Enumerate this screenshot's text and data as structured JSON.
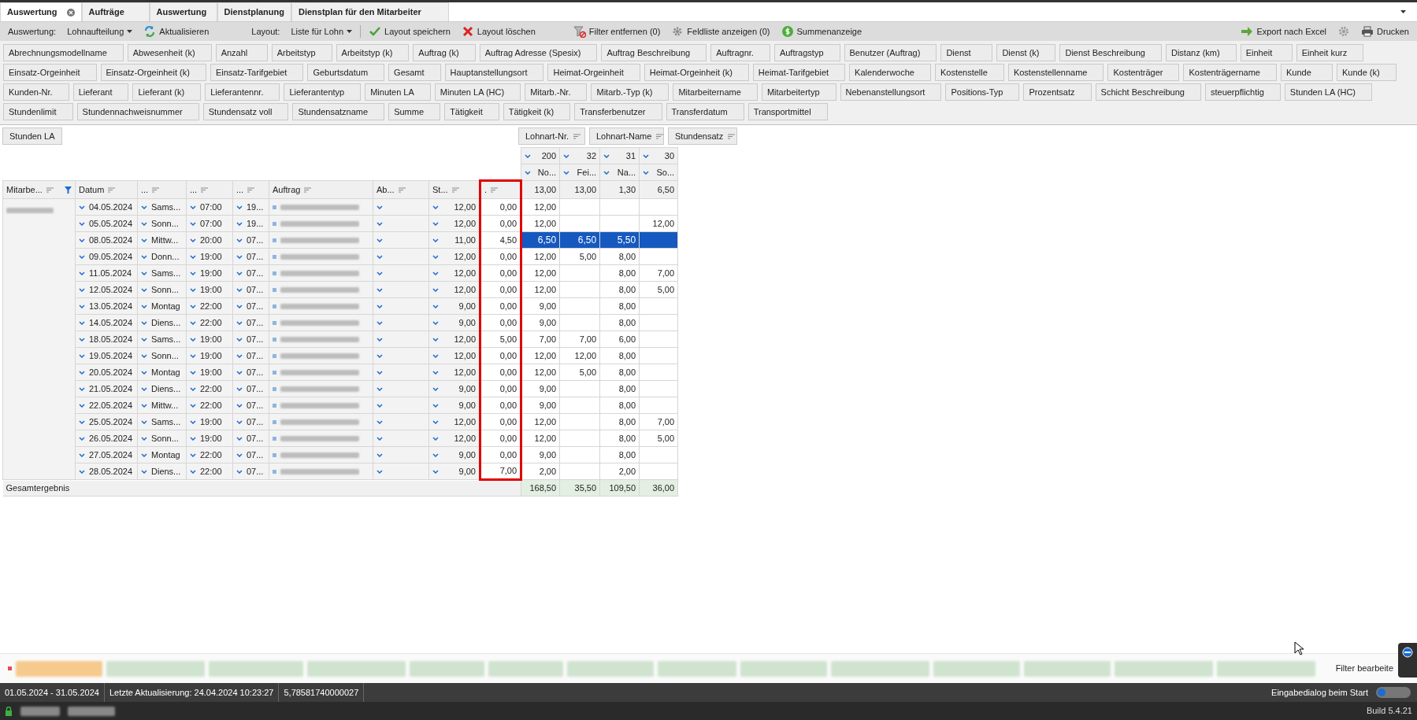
{
  "tabs": [
    {
      "label": "Auswertung",
      "selected": true,
      "closable": true
    },
    {
      "label": "Aufträge",
      "selected": false,
      "closable": false
    },
    {
      "label": "Auswertung",
      "selected": false,
      "closable": false
    },
    {
      "label": "Dienstplanung",
      "selected": false,
      "closable": false
    },
    {
      "label": "Dienstplan für den Mitarbeiter",
      "selected": false,
      "closable": false
    }
  ],
  "toolbar": [
    {
      "kind": "label",
      "text": "Auswertung:"
    },
    {
      "kind": "dropdown",
      "text": "Lohnaufteilung"
    },
    {
      "kind": "refresh",
      "text": "Aktualisieren"
    },
    {
      "kind": "label",
      "text": "Layout:"
    },
    {
      "kind": "dropdown",
      "text": "Liste für Lohn"
    },
    {
      "kind": "save",
      "text": "Layout speichern"
    },
    {
      "kind": "delete",
      "text": "Layout löschen"
    },
    {
      "kind": "filter",
      "text": "Filter entfernen (0)"
    },
    {
      "kind": "fieldlist",
      "text": "Feldliste anzeigen (0)"
    },
    {
      "kind": "sum",
      "text": "Summenanzeige"
    }
  ],
  "toolbar_right": [
    {
      "kind": "export",
      "text": "Export nach Excel"
    },
    {
      "kind": "settings"
    },
    {
      "kind": "print",
      "text": "Drucken"
    }
  ],
  "field_rows": [
    [
      "Abrechnungsmodellname",
      "Abwesenheit (k)",
      "Anzahl",
      "Arbeitstyp",
      "Arbeitstyp (k)",
      "Auftrag (k)",
      "Auftrag Adresse (Spesix)",
      "Auftrag Beschreibung",
      "Auftragnr.",
      "Auftragstyp",
      "Benutzer (Auftrag)",
      "Dienst",
      "Dienst (k)",
      "Dienst Beschreibung",
      "Distanz (km)",
      "Einheit",
      "Einheit kurz"
    ],
    [
      "Einsatz-Orgeinheit",
      "Einsatz-Orgeinheit (k)",
      "Einsatz-Tarifgebiet",
      "Geburtsdatum",
      "Gesamt",
      "Hauptanstellungsort",
      "Heimat-Orgeinheit",
      "Heimat-Orgeinheit (k)",
      "Heimat-Tarifgebiet",
      "Kalenderwoche",
      "Kostenstelle",
      "Kostenstellenname",
      "Kostenträger",
      "Kostenträgername",
      "Kunde",
      "Kunde (k)"
    ],
    [
      "Kunden-Nr.",
      "Lieferant",
      "Lieferant (k)",
      "Lieferantennr.",
      "Lieferantentyp",
      "Minuten LA",
      "Minuten LA (HC)",
      "Mitarb.-Nr.",
      "Mitarb.-Typ (k)",
      "Mitarbeitername",
      "Mitarbeitertyp",
      "Nebenanstellungsort",
      "Positions-Typ",
      "Prozentsatz",
      "Schicht Beschreibung",
      "steuerpflichtig",
      "Stunden LA (HC)"
    ],
    [
      "Stundenlimit",
      "Stundennachweisnummer",
      "Stundensatz voll",
      "Stundensatzname",
      "Summe",
      "Tätigkeit",
      "Tätigkeit (k)",
      "Transferbenutzer",
      "Transferdatum",
      "Transportmittel"
    ]
  ],
  "pivot": {
    "data_field": "Stunden LA",
    "column_fields": [
      "Lohnart-Nr.",
      "Lohnart-Name",
      "Stundensatz"
    ],
    "column_codes": [
      "200",
      "32",
      "31",
      "30"
    ],
    "column_names": [
      "No...",
      "Fei...",
      "Na...",
      "So..."
    ],
    "row_headers": [
      {
        "label": "Mitarbe...",
        "filtered": true
      },
      {
        "label": "Datum",
        "filtered": false
      },
      {
        "label": "...",
        "filtered": false
      },
      {
        "label": "...",
        "filtered": false
      },
      {
        "label": "...",
        "filtered": false
      },
      {
        "label": "Auftrag",
        "filtered": false
      },
      {
        "label": "Ab...",
        "filtered": false
      },
      {
        "label": "St...",
        "filtered": false
      },
      {
        "label": ".",
        "filtered": false
      }
    ],
    "header_totals": [
      "13,00",
      "13,00",
      "1,30",
      "6,50"
    ],
    "rows": [
      {
        "date": "04.05.2024",
        "day": "Sams...",
        "start": "07:00",
        "end": "19...",
        "hours": "12,00",
        "extra": "0,00",
        "value_1": "12,00",
        "selected": false
      },
      {
        "date": "05.05.2024",
        "day": "Sonn...",
        "start": "07:00",
        "end": "19...",
        "hours": "12,00",
        "extra": "0,00",
        "value_1": "12,00",
        "value_4": "12,00",
        "selected": false
      },
      {
        "date": "08.05.2024",
        "day": "Mittw...",
        "start": "20:00",
        "end": "07...",
        "hours": "11,00",
        "extra": "4,50",
        "value_1": "6,50",
        "value_2": "6,50",
        "value_3": "5,50",
        "selected": true
      },
      {
        "date": "09.05.2024",
        "day": "Donn...",
        "start": "19:00",
        "end": "07...",
        "hours": "12,00",
        "extra": "0,00",
        "value_1": "12,00",
        "value_2": "5,00",
        "value_3": "8,00",
        "selected": false
      },
      {
        "date": "11.05.2024",
        "day": "Sams...",
        "start": "19:00",
        "end": "07...",
        "hours": "12,00",
        "extra": "0,00",
        "value_1": "12,00",
        "value_3": "8,00",
        "value_4": "7,00",
        "selected": false
      },
      {
        "date": "12.05.2024",
        "day": "Sonn...",
        "start": "19:00",
        "end": "07...",
        "hours": "12,00",
        "extra": "0,00",
        "value_1": "12,00",
        "value_3": "8,00",
        "value_4": "5,00",
        "selected": false
      },
      {
        "date": "13.05.2024",
        "day": "Montag",
        "start": "22:00",
        "end": "07...",
        "hours": "9,00",
        "extra": "0,00",
        "value_1": "9,00",
        "value_3": "8,00",
        "selected": false
      },
      {
        "date": "14.05.2024",
        "day": "Diens...",
        "start": "22:00",
        "end": "07...",
        "hours": "9,00",
        "extra": "0,00",
        "value_1": "9,00",
        "value_3": "8,00",
        "selected": false
      },
      {
        "date": "18.05.2024",
        "day": "Sams...",
        "start": "19:00",
        "end": "07...",
        "hours": "12,00",
        "extra": "5,00",
        "value_1": "7,00",
        "value_2": "7,00",
        "value_3": "6,00",
        "selected": false
      },
      {
        "date": "19.05.2024",
        "day": "Sonn...",
        "start": "19:00",
        "end": "07...",
        "hours": "12,00",
        "extra": "0,00",
        "value_1": "12,00",
        "value_2": "12,00",
        "value_3": "8,00",
        "selected": false
      },
      {
        "date": "20.05.2024",
        "day": "Montag",
        "start": "19:00",
        "end": "07...",
        "hours": "12,00",
        "extra": "0,00",
        "value_1": "12,00",
        "value_2": "5,00",
        "value_3": "8,00",
        "selected": false
      },
      {
        "date": "21.05.2024",
        "day": "Diens...",
        "start": "22:00",
        "end": "07...",
        "hours": "9,00",
        "extra": "0,00",
        "value_1": "9,00",
        "value_3": "8,00",
        "selected": false
      },
      {
        "date": "22.05.2024",
        "day": "Mittw...",
        "start": "22:00",
        "end": "07...",
        "hours": "9,00",
        "extra": "0,00",
        "value_1": "9,00",
        "value_3": "8,00",
        "selected": false
      },
      {
        "date": "25.05.2024",
        "day": "Sams...",
        "start": "19:00",
        "end": "07...",
        "hours": "12,00",
        "extra": "0,00",
        "value_1": "12,00",
        "value_3": "8,00",
        "value_4": "7,00",
        "selected": false
      },
      {
        "date": "26.05.2024",
        "day": "Sonn...",
        "start": "19:00",
        "end": "07...",
        "hours": "12,00",
        "extra": "0,00",
        "value_1": "12,00",
        "value_3": "8,00",
        "value_4": "5,00",
        "selected": false
      },
      {
        "date": "27.05.2024",
        "day": "Montag",
        "start": "22:00",
        "end": "07...",
        "hours": "9,00",
        "extra": "0,00",
        "value_1": "9,00",
        "value_3": "8,00",
        "selected": false
      },
      {
        "date": "28.05.2024",
        "day": "Diens...",
        "start": "22:00",
        "end": "07...",
        "hours": "9,00",
        "extra": "7,00",
        "value_1": "2,00",
        "value_3": "2,00",
        "selected": false
      }
    ],
    "total_label": "Gesamtergebnis",
    "totals": [
      "168,50",
      "35,50",
      "109,50",
      "36,00"
    ]
  },
  "filter_bar": {
    "edit_button": "Filter bearbeite"
  },
  "status": {
    "period": "01.05.2024 - 31.05.2024",
    "last_update": "Letzte Aktualisierung: 24.04.2024 10:23:27",
    "value": "5,78581740000027",
    "toggle": {
      "label": "Eingabedialog beim Start",
      "on": false
    }
  },
  "footer": {
    "build": "Build 5.4.21"
  }
}
